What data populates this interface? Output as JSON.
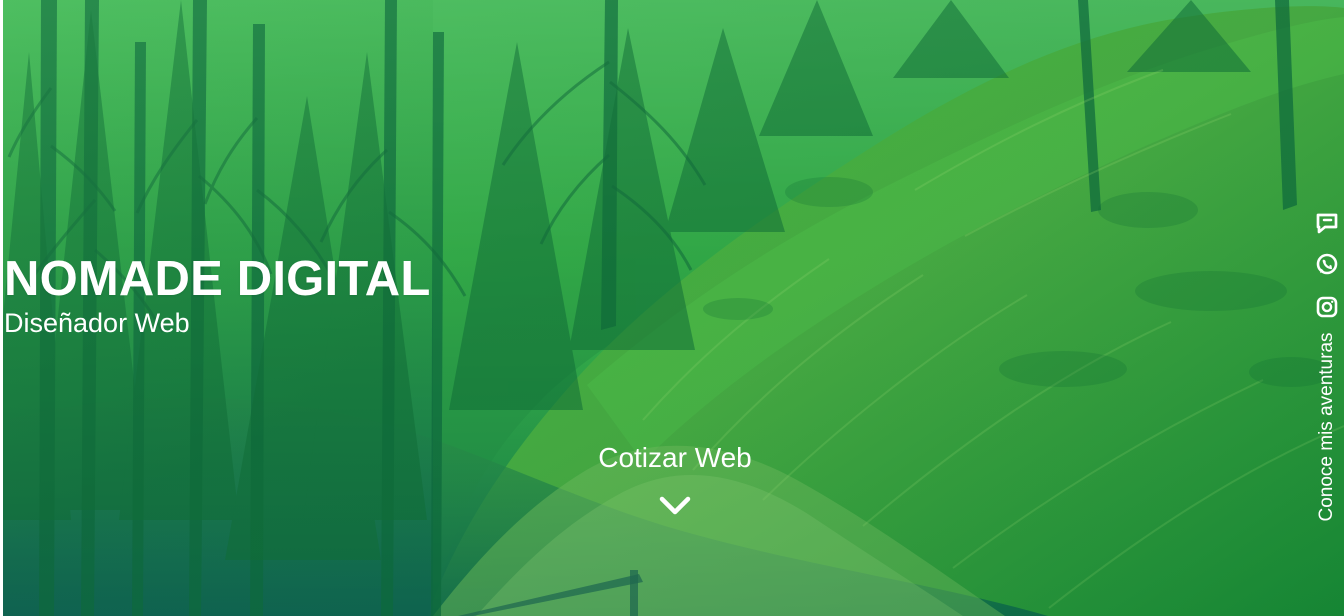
{
  "site": {
    "title": "NOMADE DIGITAL",
    "subtitle": "Diseñador Web"
  },
  "hero": {
    "background": "forest-path-photo",
    "overlay_colors": [
      "#63de6a",
      "#17a33b",
      "#0d664e"
    ]
  },
  "cta": {
    "label": "Cotizar Web",
    "icon": "chevron-down-icon"
  },
  "social": {
    "items": [
      {
        "label": "chat-icon",
        "icon": "chat-icon"
      },
      {
        "label": "whatsapp-icon",
        "icon": "whatsapp-icon"
      },
      {
        "label": "instagram-icon",
        "icon": "instagram-icon"
      }
    ],
    "adventures_label": "Conoce mis aventuras"
  }
}
